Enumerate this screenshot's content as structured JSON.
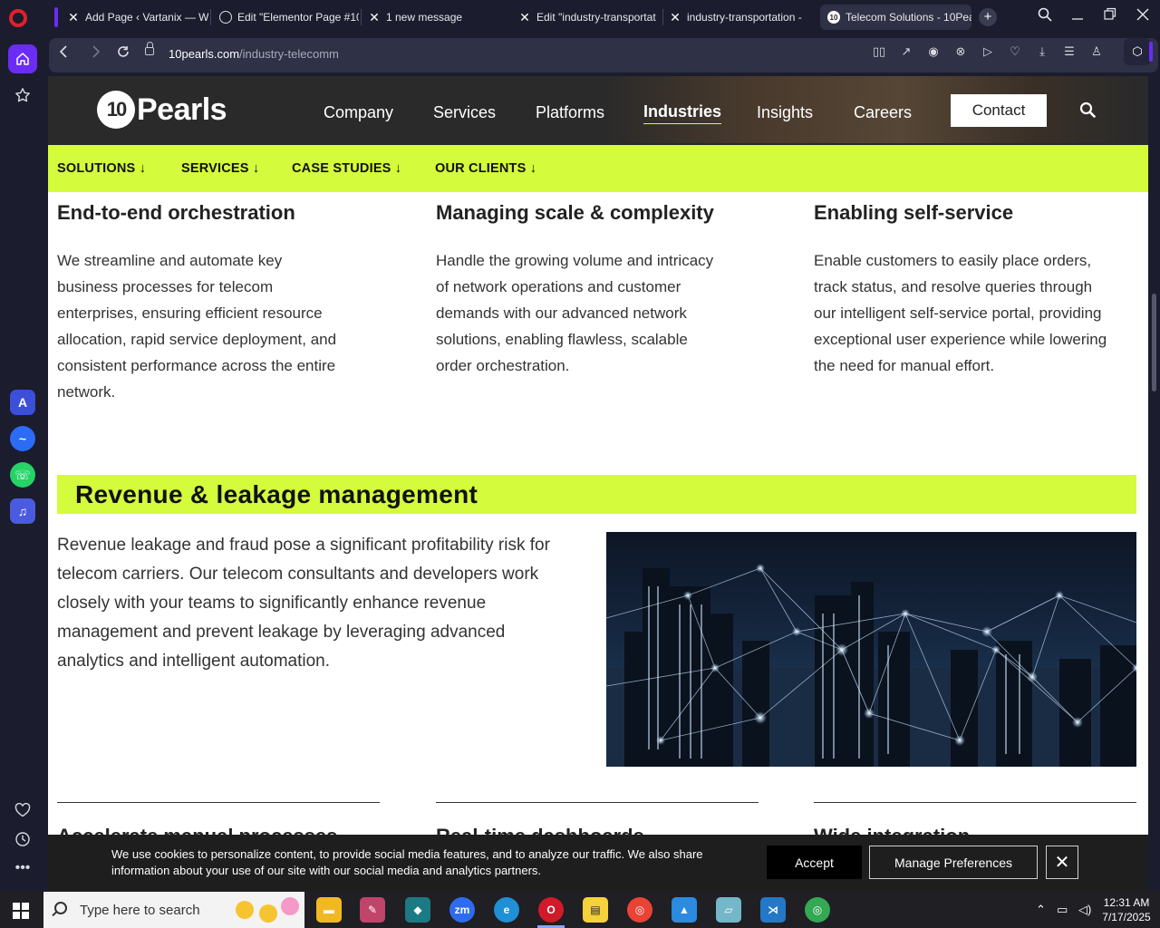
{
  "browser": {
    "tabs": [
      {
        "title": "Add Page ‹ Vartanix — W",
        "favicon": "x-logo-icon"
      },
      {
        "title": "Edit \"Elementor Page #10",
        "favicon": "globe-icon"
      },
      {
        "title": "1 new message",
        "favicon": "x-logo-icon"
      },
      {
        "title": "Edit \"industry-transportat",
        "favicon": "x-logo-icon"
      },
      {
        "title": "industry-transportation -",
        "favicon": "x-logo-icon"
      },
      {
        "title": "Telecom Solutions - 10Pea",
        "favicon": "10pearls-icon",
        "active": true
      }
    ],
    "url": {
      "domain": "10pearls.com",
      "path": "/industry-telecomm"
    }
  },
  "site": {
    "logo_mark": "10",
    "logo_text": "Pearls",
    "nav": [
      {
        "label": "Company"
      },
      {
        "label": "Services"
      },
      {
        "label": "Platforms"
      },
      {
        "label": "Industries",
        "active": true
      },
      {
        "label": "Insights"
      },
      {
        "label": "Careers"
      }
    ],
    "contact_label": "Contact",
    "subnav": [
      {
        "label": "SOLUTIONS ↓"
      },
      {
        "label": "SERVICES ↓"
      },
      {
        "label": "CASE STUDIES ↓"
      },
      {
        "label": "OUR CLIENTS ↓"
      }
    ],
    "accent_color": "#d4fb3c"
  },
  "features": [
    {
      "title": "End-to-end orchestration",
      "body": "We streamline and automate key business processes for telecom enterprises, ensuring efficient resource allocation, rapid service deployment, and consistent performance across the entire network."
    },
    {
      "title": "Managing scale & complexity",
      "body": "Handle the growing volume and intricacy of network operations and customer demands with our advanced network solutions, enabling flawless, scalable order orchestration."
    },
    {
      "title": "Enabling self-service",
      "body": "Enable customers to easily place orders, track status, and resolve queries through our intelligent self-service portal, providing exceptional user experience while lowering the need for manual effort."
    }
  ],
  "revenue": {
    "heading": "Revenue & leakage management",
    "body": "Revenue leakage and fraud pose a significant profitability risk for telecom carriers. Our telecom consultants and developers work closely with your teams to significantly enhance revenue management and prevent leakage by leveraging advanced analytics and intelligent automation."
  },
  "next_features": [
    {
      "title": "Accelerate manual processes"
    },
    {
      "title": "Real-time dashboards"
    },
    {
      "title": "Wide integration"
    }
  ],
  "cookie": {
    "text": "We use cookies to personalize content, to provide social media features, and to analyze our traffic. We also share information about your use of our site with our social media and analytics partners.",
    "accept_label": "Accept",
    "manage_label": "Manage Preferences",
    "close_label": "✕"
  },
  "taskbar": {
    "search_placeholder": "Type here to search",
    "time": "12:31 AM",
    "date": "7/17/2025"
  }
}
